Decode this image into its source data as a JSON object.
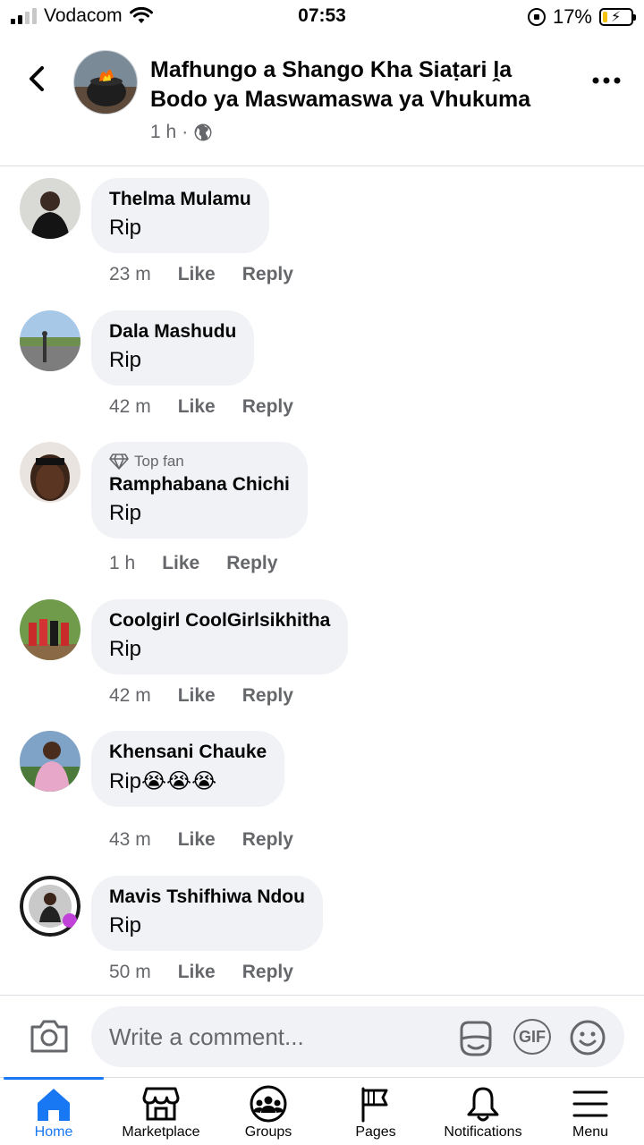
{
  "status_bar": {
    "carrier": "Vodacom",
    "time": "07:53",
    "battery_percent": "17%",
    "battery_level": 0.17
  },
  "header": {
    "back_icon": "chevron-left-icon",
    "title": "Mafhungo a Shango Kha Siaṭari ḽa Bodo ya Maswamaswa ya Vhukuma",
    "time": "1 h",
    "separator": "·",
    "privacy_icon": "globe-icon",
    "more_icon": "more-horizontal-icon"
  },
  "comments": [
    {
      "name": "Thelma Mulamu",
      "text": "Rip",
      "time": "23 m",
      "like": "Like",
      "reply": "Reply",
      "badge": ""
    },
    {
      "name": "Dala Mashudu",
      "text": "Rip",
      "time": "42 m",
      "like": "Like",
      "reply": "Reply",
      "badge": ""
    },
    {
      "name": "Ramphabana Chichi",
      "text": "Rip",
      "time": "1 h",
      "like": "Like",
      "reply": "Reply",
      "badge": "Top fan"
    },
    {
      "name": "Coolgirl CoolGirlsikhitha",
      "text": "Rip",
      "time": "42 m",
      "like": "Like",
      "reply": "Reply",
      "badge": ""
    },
    {
      "name": "Khensani Chauke",
      "text": "Rip😭😭😭",
      "time": "43 m",
      "like": "Like",
      "reply": "Reply",
      "badge": ""
    },
    {
      "name": "Mavis Tshifhiwa Ndou",
      "text": "Rip",
      "time": "50 m",
      "like": "Like",
      "reply": "Reply",
      "badge": ""
    }
  ],
  "composer": {
    "placeholder": "Write a comment...",
    "camera_icon": "camera-icon",
    "sticker_icon": "sticker-icon",
    "gif_label": "GIF",
    "emoji_icon": "emoji-icon"
  },
  "tabs": [
    {
      "label": "Home",
      "icon": "home-icon",
      "active": true
    },
    {
      "label": "Marketplace",
      "icon": "marketplace-icon",
      "active": false
    },
    {
      "label": "Groups",
      "icon": "groups-icon",
      "active": false
    },
    {
      "label": "Pages",
      "icon": "pages-flag-icon",
      "active": false
    },
    {
      "label": "Notifications",
      "icon": "bell-icon",
      "active": false
    },
    {
      "label": "Menu",
      "icon": "menu-icon",
      "active": false
    }
  ],
  "colors": {
    "accent": "#1877f2",
    "bubble": "#f0f2f5",
    "secondary_text": "#65676b"
  }
}
